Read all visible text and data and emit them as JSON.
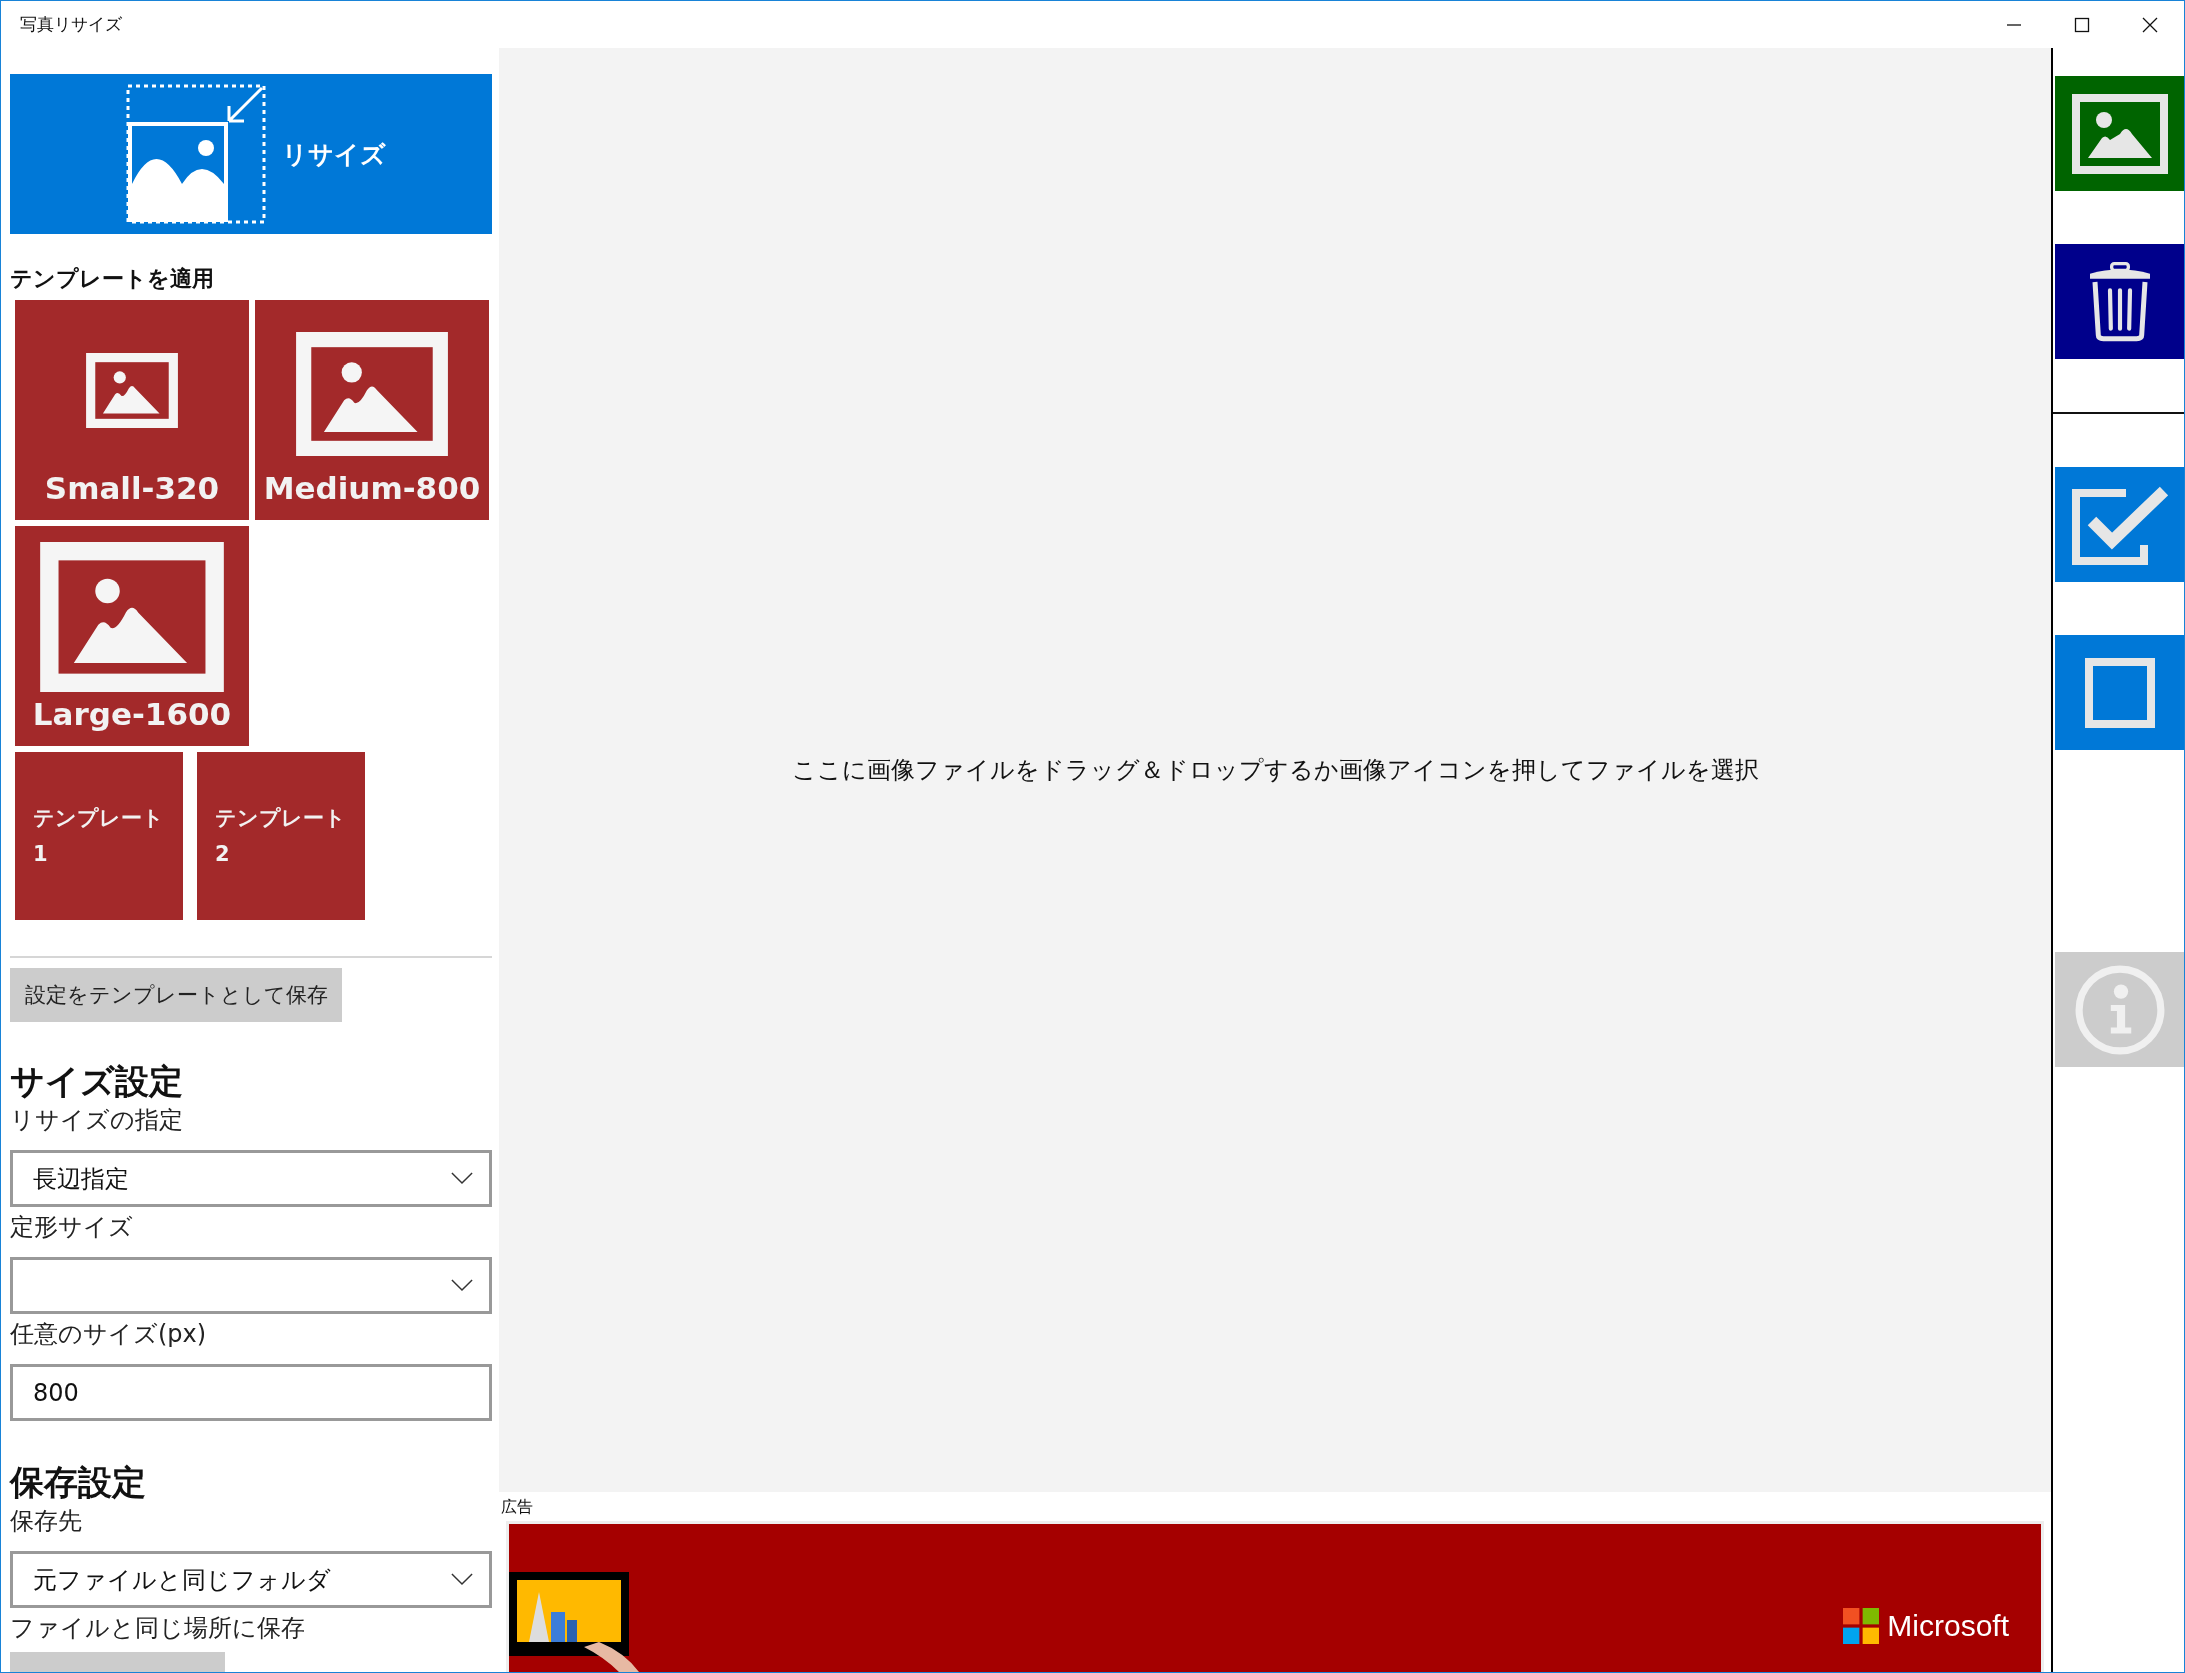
{
  "window": {
    "title": "写真リサイズ"
  },
  "resize_button": {
    "label": "リサイズ"
  },
  "templates": {
    "heading": "テンプレートを適用",
    "tiles": [
      {
        "kind": "small",
        "label": "Small-320"
      },
      {
        "kind": "medium",
        "label": "Medium-800"
      },
      {
        "kind": "large",
        "label": "Large-1600"
      },
      {
        "kind": "text",
        "label": "テンプレート\n1"
      },
      {
        "kind": "text",
        "label": "テンプレート\n2"
      }
    ]
  },
  "save_template_button": "設定をテンプレートとして保存",
  "size_settings": {
    "heading": "サイズ設定",
    "fields": [
      {
        "kind": "dropdown",
        "label": "リサイズの指定",
        "value": "長辺指定"
      },
      {
        "kind": "dropdown",
        "label": "定形サイズ"
      },
      {
        "kind": "text",
        "label": "任意のサイズ(px)",
        "value": "800"
      }
    ]
  },
  "save_settings": {
    "heading": "保存設定",
    "fields": [
      {
        "kind": "dropdown",
        "label": "保存先",
        "value": "元ファイルと同じフォルダ"
      },
      {
        "kind": "note",
        "value": "ファイルと同じ場所に保存"
      },
      {
        "kind": "button"
      }
    ]
  },
  "drop_hint": "ここに画像ファイルをドラッグ＆ドロップするか画像アイコンを押してファイルを選択",
  "ad": {
    "label": "広告",
    "brand": "Microsoft"
  },
  "sidebar": [
    {
      "kind": "image",
      "color": "#006400"
    },
    {
      "kind": "trash",
      "color": "#00008b"
    },
    {
      "kind": "checkall",
      "color": "#0078d7"
    },
    {
      "kind": "uncheckall",
      "color": "#0078d7"
    },
    {
      "kind": "info",
      "color": "#cccccc"
    }
  ]
}
